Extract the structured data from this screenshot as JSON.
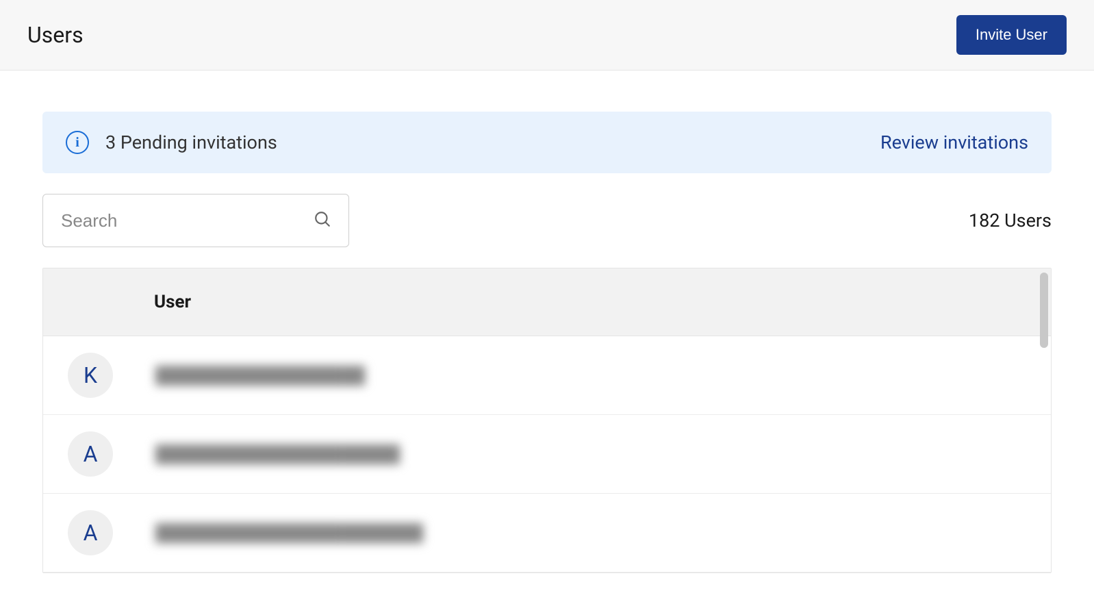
{
  "header": {
    "title": "Users",
    "invite_label": "Invite User"
  },
  "banner": {
    "icon_glyph": "i",
    "message": "3 Pending invitations",
    "action_label": "Review invitations"
  },
  "search": {
    "placeholder": "Search"
  },
  "summary": {
    "count_text": "182 Users"
  },
  "table": {
    "column_header": "User",
    "rows": [
      {
        "initial": "K",
        "email": "██████████████████"
      },
      {
        "initial": "A",
        "email": "█████████████████████"
      },
      {
        "initial": "A",
        "email": "███████████████████████"
      }
    ]
  }
}
